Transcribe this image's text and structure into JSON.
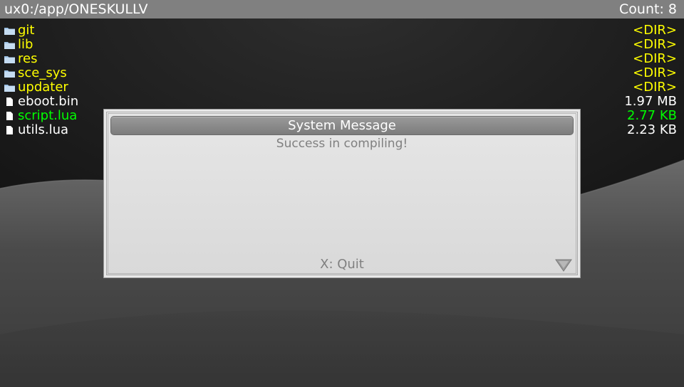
{
  "top_bar": {
    "path": "ux0:/app/ONESKULLV",
    "count": "Count: 8"
  },
  "files": [
    {
      "name": "git",
      "size": "<DIR>",
      "type": "folder",
      "state": "dir"
    },
    {
      "name": "lib",
      "size": "<DIR>",
      "type": "folder",
      "state": "dir"
    },
    {
      "name": "res",
      "size": "<DIR>",
      "type": "folder",
      "state": "dir"
    },
    {
      "name": "sce_sys",
      "size": "<DIR>",
      "type": "folder",
      "state": "dir"
    },
    {
      "name": "updater",
      "size": "<DIR>",
      "type": "folder",
      "state": "dir"
    },
    {
      "name": "eboot.bin",
      "size": "1.97 MB",
      "type": "file",
      "state": "file"
    },
    {
      "name": "script.lua",
      "size": "2.77 KB",
      "type": "file",
      "state": "selected"
    },
    {
      "name": "utils.lua",
      "size": "2.23 KB",
      "type": "file",
      "state": "file"
    }
  ],
  "dialog": {
    "title": "System Message",
    "message": "Success in compiling!",
    "action": "X: Quit",
    "arrow_icon": "triangle-down-icon"
  },
  "colors": {
    "top_bar_bg": "#808080",
    "dir": "#ffff00",
    "file": "#ffffff",
    "selected": "#00ff00",
    "dialog_title_bg": "#8a8a8a",
    "dialog_text": "#808080"
  },
  "icons": {
    "folder": "folder-icon",
    "file": "file-icon"
  }
}
